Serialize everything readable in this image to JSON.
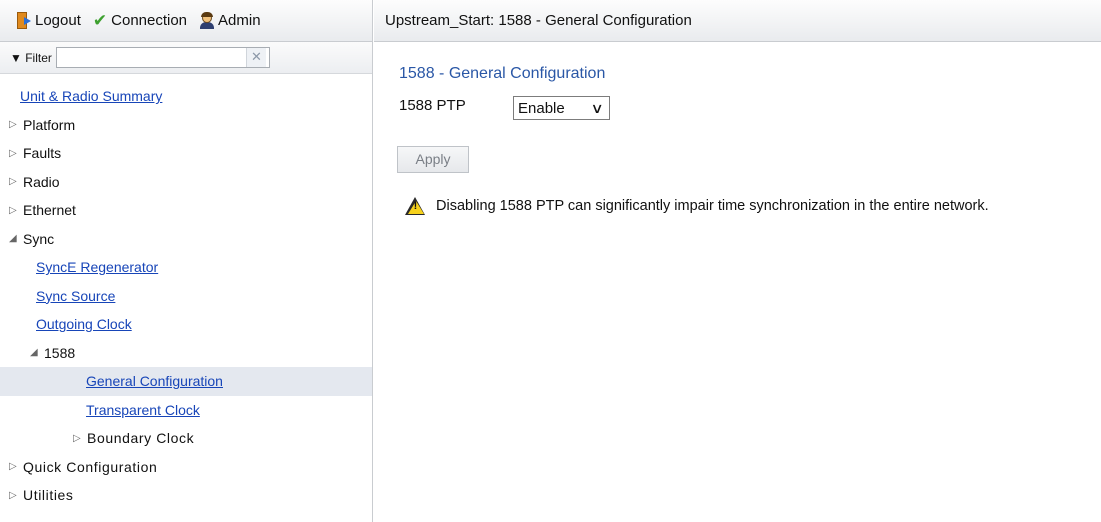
{
  "topbar": {
    "logout_label": "Logout",
    "connection_label": "Connection",
    "admin_label": "Admin"
  },
  "filter": {
    "label": "▼ Filter",
    "value": "",
    "clear_symbol": "✕"
  },
  "tree": {
    "unit_radio_summary": "Unit & Radio Summary",
    "platform": "Platform",
    "faults": "Faults",
    "radio": "Radio",
    "ethernet": "Ethernet",
    "sync": "Sync",
    "synce_regenerator": "SyncE Regenerator",
    "sync_source": "Sync Source",
    "outgoing_clock": "Outgoing Clock",
    "n1588": "1588",
    "general_configuration": "General Configuration",
    "transparent_clock": "Transparent Clock",
    "boundary_clock": "Boundary Clock",
    "quick_configuration": "Quick Configuration",
    "utilities": "Utilities",
    "collapsed_symbol": "▷",
    "expanded_symbol": "◢"
  },
  "main": {
    "header_title": "Upstream_Start: 1588 - General Configuration",
    "section_title": "1588 - General Configuration",
    "ptp_label": "1588 PTP",
    "ptp_value": "Enable",
    "apply_label": "Apply",
    "warning_text": "Disabling 1588 PTP can significantly impair time synchronization in the entire network."
  },
  "colors": {
    "link": "#1745b8",
    "section_title": "#2a57a6",
    "selected_row": "#e4e8ef",
    "warning_yellow": "#f7d21c"
  },
  "icons": {
    "logout": "logout-door-icon",
    "connection": "checkmark-icon",
    "admin": "admin-user-icon",
    "warning": "warning-triangle-icon"
  }
}
